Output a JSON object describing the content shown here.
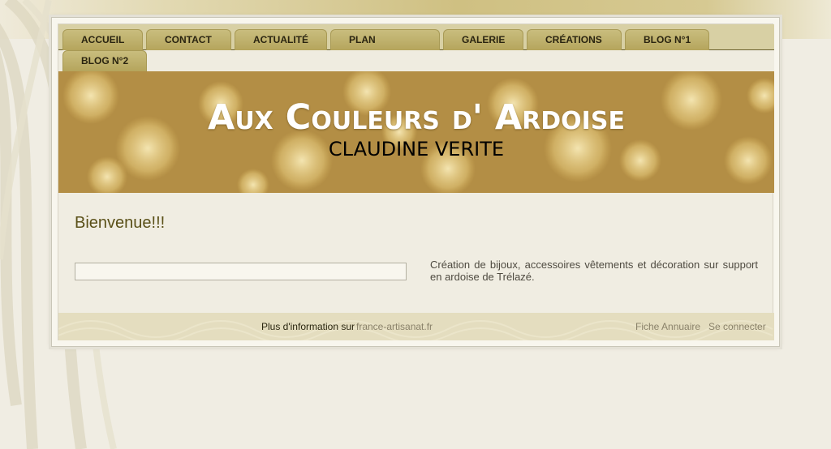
{
  "nav": {
    "tabs": [
      {
        "label": "ACCUEIL"
      },
      {
        "label": "CONTACT"
      },
      {
        "label": "ACTUALITÉ"
      },
      {
        "label": "PLAN"
      },
      {
        "label": "GALERIE"
      },
      {
        "label": "CRÉATIONS"
      },
      {
        "label": "BLOG N°1"
      },
      {
        "label": "BLOG N°2"
      }
    ]
  },
  "banner": {
    "title": "Aux Couleurs d' Ardoise",
    "subtitle": "CLAUDINE VERITE"
  },
  "content": {
    "welcome": "Bienvenue!!!",
    "search_value": "",
    "description": "Création de bijoux, accessoires vêtements et décoration sur support en ardoise de Trélazé."
  },
  "footer": {
    "info_prefix": "Plus d'information sur",
    "info_link": "france-artisanat.fr",
    "fiche_link": "Fiche Annuaire",
    "login_link": "Se connecter"
  },
  "colors": {
    "page_bg": "#f0ede3",
    "nav_bar": "#d8d0a4",
    "tab": "#c0b26c",
    "title_text": "#ffffff",
    "welcome_text": "#5a5018",
    "link_text": "#8a826a"
  }
}
